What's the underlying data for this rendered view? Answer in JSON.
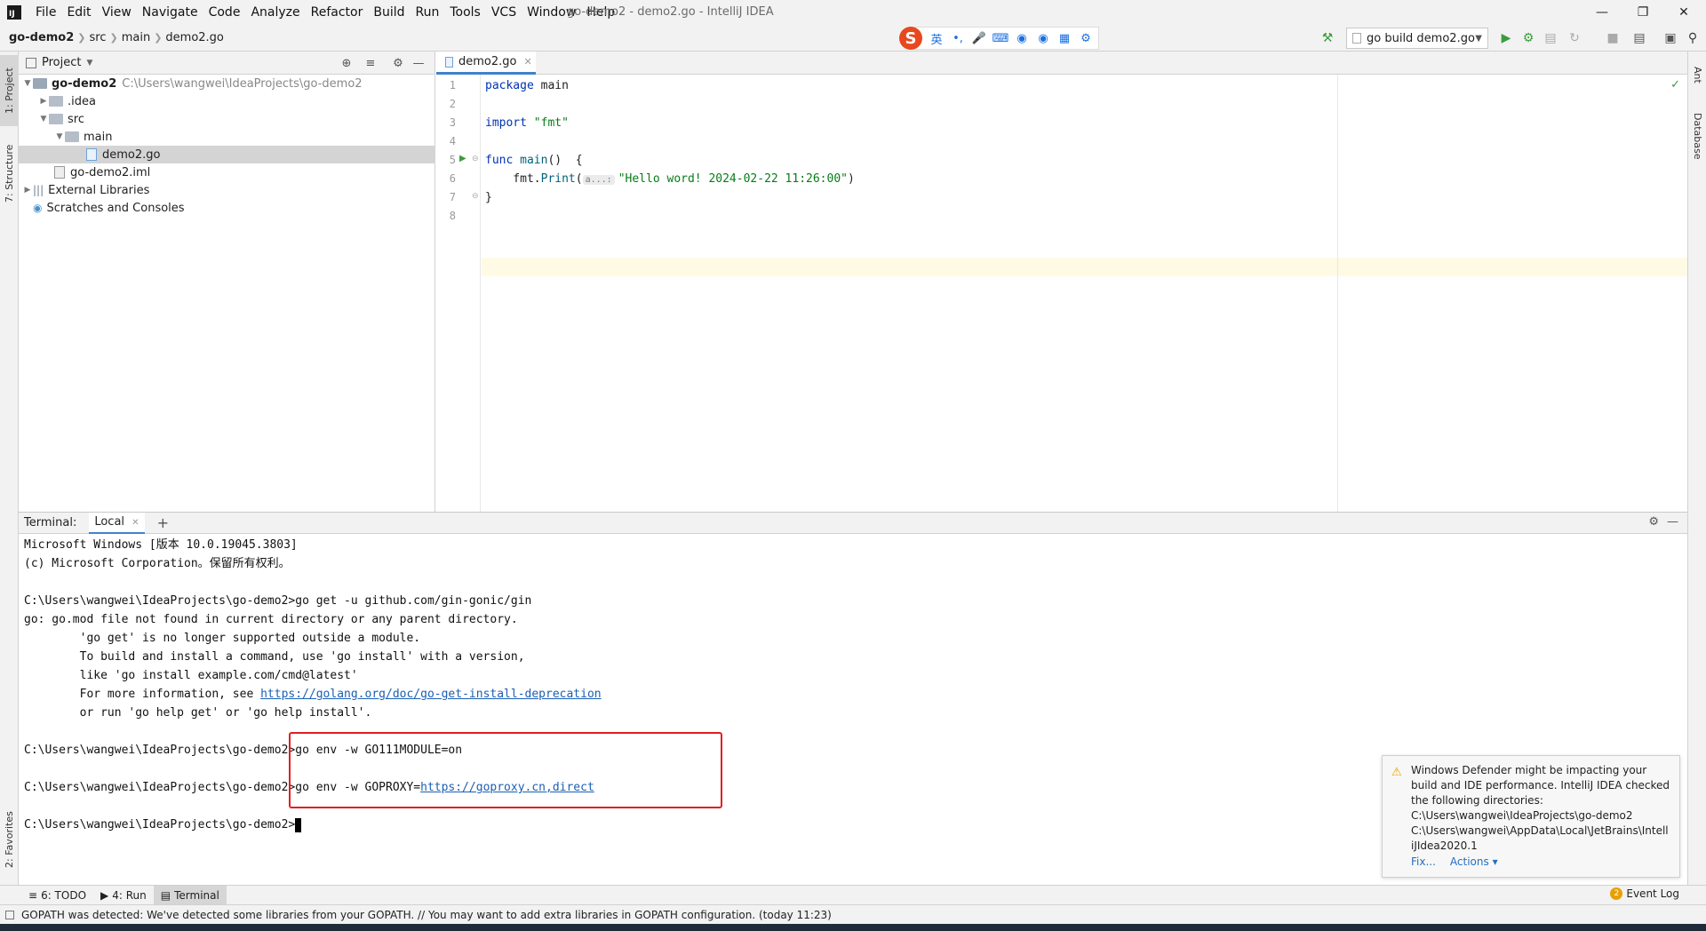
{
  "window": {
    "title": "go-demo2 - demo2.go - IntelliJ IDEA",
    "logo": "IJ"
  },
  "menu": [
    "File",
    "Edit",
    "View",
    "Navigate",
    "Code",
    "Analyze",
    "Refactor",
    "Build",
    "Run",
    "Tools",
    "VCS",
    "Window",
    "Help"
  ],
  "breadcrumbs": [
    "go-demo2",
    "src",
    "main",
    "demo2.go"
  ],
  "ime": {
    "logo": "S",
    "lang": "英"
  },
  "run_config": {
    "label": "go build demo2.go"
  },
  "left_tabs": {
    "project": "1: Project",
    "structure": "7: Structure",
    "favorites": "2: Favorites"
  },
  "right_tabs": {
    "ant": "Ant",
    "database": "Database"
  },
  "project": {
    "header": "Project",
    "tree": [
      {
        "label": "go-demo2",
        "path": "C:\\Users\\wangwei\\IdeaProjects\\go-demo2"
      },
      {
        "label": ".idea"
      },
      {
        "label": "src"
      },
      {
        "label": "main"
      },
      {
        "label": "demo2.go"
      },
      {
        "label": "go-demo2.iml"
      },
      {
        "label": "External Libraries"
      },
      {
        "label": "Scratches and Consoles"
      }
    ]
  },
  "editor": {
    "tab": "demo2.go",
    "line_numbers": [
      "1",
      "2",
      "3",
      "4",
      "5",
      "6",
      "7",
      "8"
    ],
    "code": {
      "l1_kw": "package",
      "l1_name": " main",
      "l3_kw": "import",
      "l3_str": " \"fmt\"",
      "l5_kw": "func",
      "l5_fn": " main",
      "l5_rest": "()  {",
      "l6_pre": "    fmt.",
      "l6_fn": "Print",
      "l6_open": "(",
      "l6_hint": "a...:",
      "l6_str": "\"Hello word! 2024-02-22 11:26:00\"",
      "l6_close": ")",
      "l7": "}"
    }
  },
  "terminal": {
    "label": "Terminal:",
    "tab": "Local",
    "lines": {
      "l1": "Microsoft Windows [版本 10.0.19045.3803]",
      "l2": "(c) Microsoft Corporation。保留所有权利。",
      "l4": "C:\\Users\\wangwei\\IdeaProjects\\go-demo2>go get -u github.com/gin-gonic/gin",
      "l5": "go: go.mod file not found in current directory or any parent directory.",
      "l6": "        'go get' is no longer supported outside a module.",
      "l7": "        To build and install a command, use 'go install' with a version,",
      "l8": "        like 'go install example.com/cmd@latest'",
      "l9_pre": "        For more information, see ",
      "l9_link": "https://golang.org/doc/go-get-install-deprecation",
      "l10": "        or run 'go help get' or 'go help install'.",
      "l12": "C:\\Users\\wangwei\\IdeaProjects\\go-demo2>go env -w GO111MODULE=on",
      "l14_pre": "C:\\Users\\wangwei\\IdeaProjects\\go-demo2>go env -w GOPROXY=",
      "l14_link": "https://goproxy.cn,direct",
      "l16": "C:\\Users\\wangwei\\IdeaProjects\\go-demo2>"
    }
  },
  "notification": {
    "text": "Windows Defender might be impacting your build and IDE performance. IntelliJ IDEA checked the following directories:",
    "dir1": "C:\\Users\\wangwei\\IdeaProjects\\go-demo2",
    "dir2": "C:\\Users\\wangwei\\AppData\\Local\\JetBrains\\IntelliJIdea2020.1",
    "fix": "Fix...",
    "actions": "Actions ▾"
  },
  "tool_tabs": {
    "todo": "6: TODO",
    "run": "4: Run",
    "terminal": "Terminal"
  },
  "event_log": {
    "count": "2",
    "label": "Event Log"
  },
  "status": {
    "message": "GOPATH was detected: We've detected some libraries from your GOPATH. // You may want to add extra libraries in GOPATH configuration. (today 11:23)"
  }
}
